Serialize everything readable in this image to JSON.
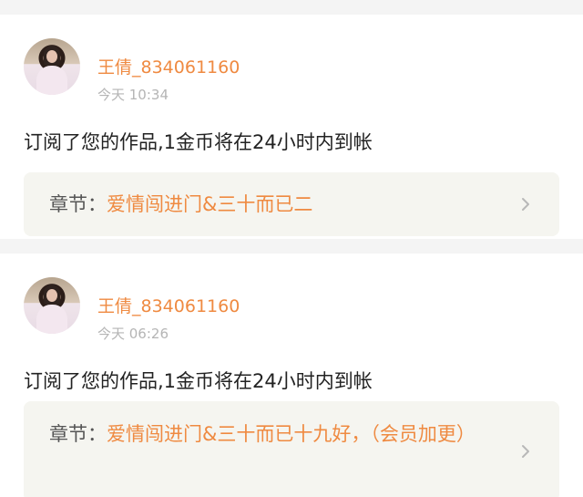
{
  "notifications": [
    {
      "username": "王倩_834061160",
      "time": "今天 10:34",
      "message": "订阅了您的作品,1金币将在24小时内到帐",
      "chapter_prefix": "章节：",
      "chapter_title": "爱情闯进门&三十而已二"
    },
    {
      "username": "王倩_834061160",
      "time": "今天 06:26",
      "message": "订阅了您的作品,1金币将在24小时内到帐",
      "chapter_prefix": "章节：",
      "chapter_title": "爱情闯进门&三十而已十九好，（会员加更）"
    }
  ],
  "colors": {
    "accent": "#ef8a41",
    "text": "#222222",
    "muted": "#b5b5b5",
    "chapter_bg": "#f5f5f0",
    "page_bg": "#f4f4f4"
  },
  "icons": {
    "chevron": "chevron-right-icon",
    "avatar": "avatar"
  }
}
